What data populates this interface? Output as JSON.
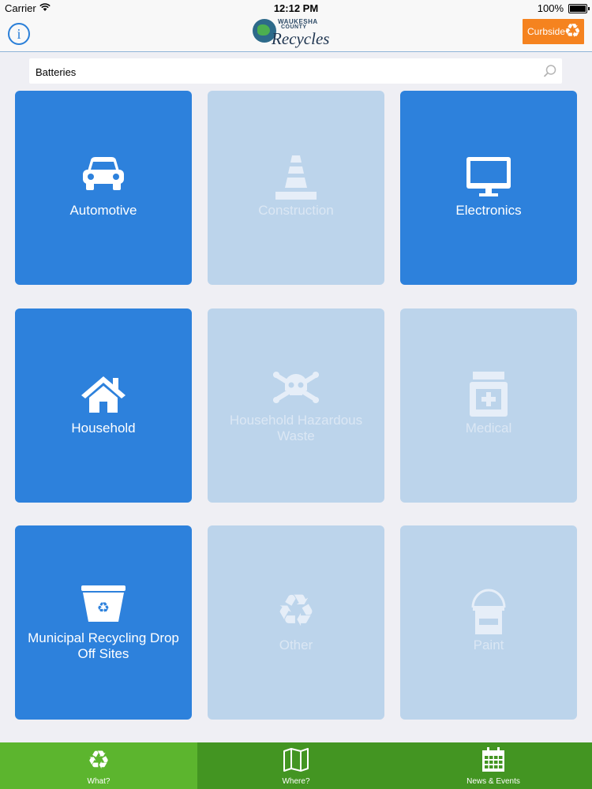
{
  "status_bar": {
    "carrier": "Carrier",
    "time": "12:12 PM",
    "battery": "100%"
  },
  "header": {
    "info_label": "i",
    "logo": {
      "line1": "WAUKESHA",
      "line2": "COUNTY",
      "line3": "Recycles"
    },
    "curbside_label": "Curbside",
    "curbside_icon": "recycle-icon"
  },
  "search": {
    "value": "Batteries",
    "icon": "search-icon"
  },
  "categories": [
    {
      "label": "Automotive",
      "icon": "car-icon",
      "enabled": true
    },
    {
      "label": "Construction",
      "icon": "traffic-cone-icon",
      "enabled": false
    },
    {
      "label": "Electronics",
      "icon": "monitor-icon",
      "enabled": true
    },
    {
      "label": "Household",
      "icon": "house-icon",
      "enabled": true
    },
    {
      "label": "Household Hazardous Waste",
      "icon": "skull-crossbones-icon",
      "enabled": false
    },
    {
      "label": "Medical",
      "icon": "medicine-bottle-icon",
      "enabled": false
    },
    {
      "label": "Municipal Recycling Drop Off Sites",
      "icon": "recycling-bin-icon",
      "enabled": true
    },
    {
      "label": "Other",
      "icon": "recycle-icon",
      "enabled": false
    },
    {
      "label": "Paint",
      "icon": "paint-bucket-icon",
      "enabled": false
    }
  ],
  "tabs": [
    {
      "label": "What?",
      "icon": "recycle-icon",
      "selected": true
    },
    {
      "label": "Where?",
      "icon": "map-icon",
      "selected": false
    },
    {
      "label": "News & Events",
      "icon": "calendar-icon",
      "selected": false
    }
  ],
  "colors": {
    "tile_active": "#2d81dc",
    "tile_inactive": "#bcd4eb",
    "curbside": "#f5831f",
    "tab_selected": "#5cb52e",
    "tab_normal": "#439522",
    "accent": "#2a7fd8"
  }
}
